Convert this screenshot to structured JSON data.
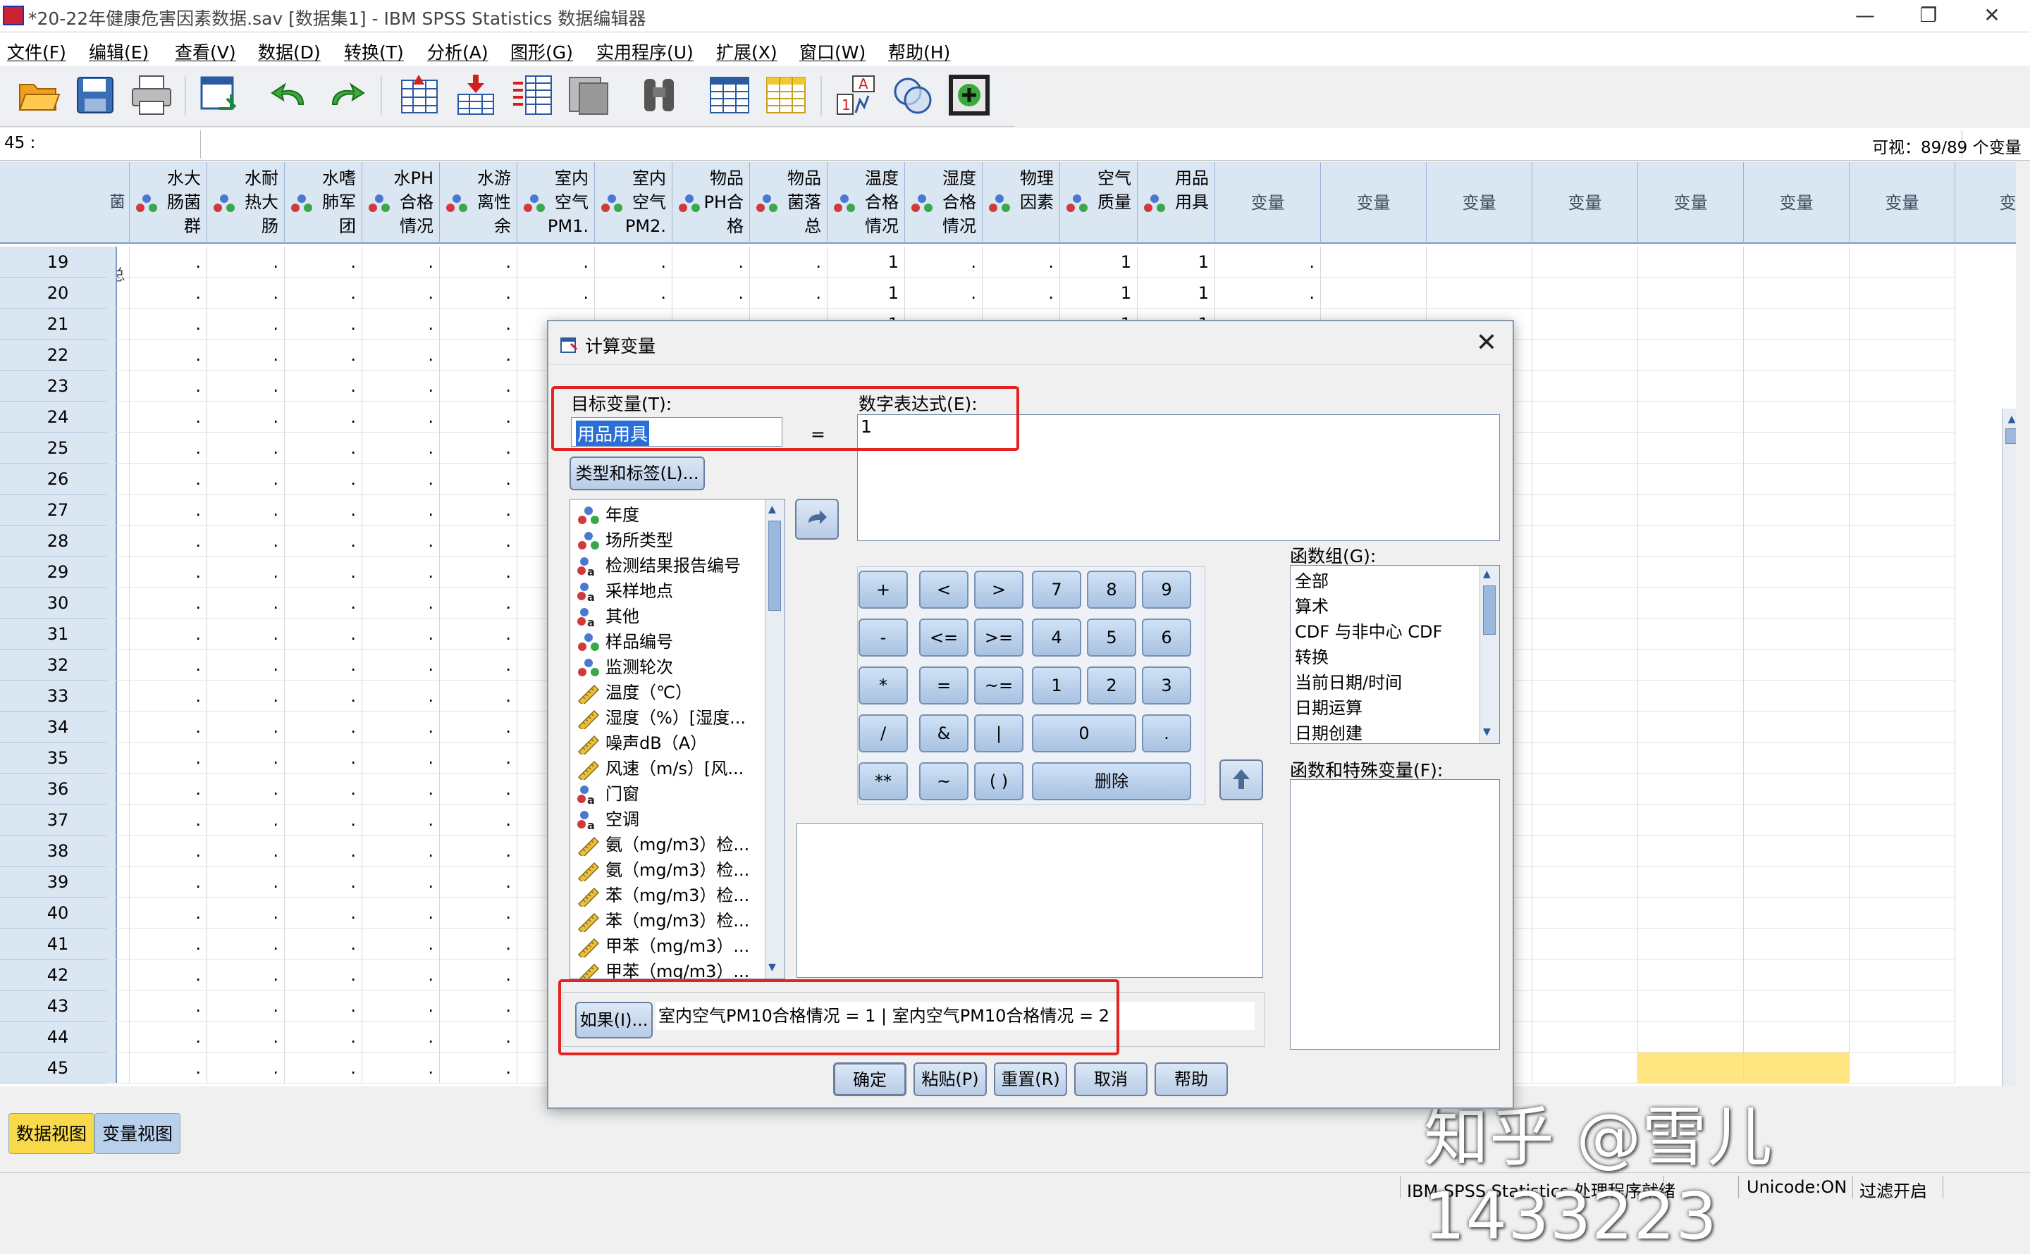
{
  "window": {
    "title": "*20-22年健康危害因素数据.sav [数据集1] - IBM SPSS Statistics 数据编辑器",
    "minimize": "—",
    "restore": "❐",
    "close": "✕"
  },
  "menus": [
    "文件(F)",
    "编辑(E)",
    "查看(V)",
    "数据(D)",
    "转换(T)",
    "分析(A)",
    "图形(G)",
    "实用程序(U)",
    "扩展(X)",
    "窗口(W)",
    "帮助(H)"
  ],
  "toolbar_icons": [
    "open-icon",
    "save-icon",
    "print-icon",
    "dialog-recall-icon",
    "undo-icon",
    "redo-icon",
    "goto-case-icon",
    "goto-variable-icon",
    "variables-icon",
    "run-descriptives-icon",
    "find-icon",
    "insert-cases-icon",
    "insert-variable-icon",
    "split-file-icon",
    "weight-cases-icon",
    "select-cases-icon",
    "value-labels-icon",
    "use-sets-icon"
  ],
  "cell_editor": {
    "reference": "45 :",
    "visible_count": "可视：89/89 个变量"
  },
  "columns": [
    {
      "label": "菌总",
      "partial": true
    },
    {
      "label": "水大肠菌群"
    },
    {
      "label": "水耐热大肠"
    },
    {
      "label": "水嗜肺军团"
    },
    {
      "label": "水PH合格情况"
    },
    {
      "label": "水游离性余"
    },
    {
      "label": "室内空气PM1."
    },
    {
      "label": "室内空气PM2."
    },
    {
      "label": "物品PH合格"
    },
    {
      "label": "物品菌落总"
    },
    {
      "label": "温度合格情况"
    },
    {
      "label": "湿度合格情况"
    },
    {
      "label": "物理因素"
    },
    {
      "label": "空气质量"
    },
    {
      "label": "用品用具"
    },
    {
      "label": "变量"
    },
    {
      "label": "变量"
    },
    {
      "label": "变量"
    },
    {
      "label": "变量"
    },
    {
      "label": "变量"
    },
    {
      "label": "变量"
    },
    {
      "label": "变量"
    },
    {
      "label": "变",
      "partial": true
    }
  ],
  "rows": [
    {
      "n": "19",
      "cells": [
        ".",
        ".",
        ".",
        ".",
        ".",
        ".",
        ".",
        ".",
        ".",
        "1",
        ".",
        ".",
        "1",
        "1",
        "."
      ]
    },
    {
      "n": "20",
      "cells": [
        ".",
        ".",
        ".",
        ".",
        ".",
        ".",
        ".",
        ".",
        ".",
        "1",
        ".",
        ".",
        "1",
        "1",
        "."
      ]
    },
    {
      "n": "21",
      "cells": [
        ".",
        ".",
        ".",
        ".",
        ".",
        ".",
        ".",
        ".",
        ".",
        "1",
        ".",
        ".",
        "1",
        "1",
        "."
      ]
    },
    {
      "n": "22",
      "cells": [
        ".",
        ".",
        ".",
        ".",
        ".",
        "."
      ]
    },
    {
      "n": "23",
      "cells": [
        ".",
        ".",
        ".",
        ".",
        ".",
        "."
      ]
    },
    {
      "n": "24",
      "cells": [
        ".",
        ".",
        ".",
        ".",
        ".",
        "."
      ]
    },
    {
      "n": "25",
      "cells": [
        ".",
        ".",
        ".",
        ".",
        ".",
        "."
      ]
    },
    {
      "n": "26",
      "cells": [
        ".",
        ".",
        ".",
        ".",
        ".",
        "."
      ]
    },
    {
      "n": "27",
      "cells": [
        ".",
        ".",
        ".",
        ".",
        ".",
        "."
      ]
    },
    {
      "n": "28",
      "cells": [
        ".",
        ".",
        ".",
        ".",
        ".",
        "."
      ]
    },
    {
      "n": "29",
      "cells": [
        ".",
        ".",
        ".",
        ".",
        ".",
        "."
      ]
    },
    {
      "n": "30",
      "cells": [
        ".",
        ".",
        ".",
        ".",
        ".",
        "."
      ]
    },
    {
      "n": "31",
      "cells": [
        ".",
        ".",
        ".",
        ".",
        ".",
        "."
      ]
    },
    {
      "n": "32",
      "cells": [
        ".",
        ".",
        ".",
        ".",
        ".",
        "."
      ]
    },
    {
      "n": "33",
      "cells": [
        ".",
        ".",
        ".",
        ".",
        ".",
        "."
      ]
    },
    {
      "n": "34",
      "cells": [
        ".",
        ".",
        ".",
        ".",
        ".",
        "."
      ]
    },
    {
      "n": "35",
      "cells": [
        ".",
        ".",
        ".",
        ".",
        ".",
        "."
      ]
    },
    {
      "n": "36",
      "cells": [
        ".",
        ".",
        ".",
        ".",
        ".",
        "."
      ]
    },
    {
      "n": "37",
      "cells": [
        ".",
        ".",
        ".",
        ".",
        ".",
        "."
      ]
    },
    {
      "n": "38",
      "cells": [
        ".",
        ".",
        ".",
        ".",
        ".",
        "."
      ]
    },
    {
      "n": "39",
      "cells": [
        ".",
        ".",
        ".",
        ".",
        ".",
        "."
      ]
    },
    {
      "n": "40",
      "cells": [
        ".",
        ".",
        ".",
        ".",
        ".",
        "."
      ]
    },
    {
      "n": "41",
      "cells": [
        ".",
        ".",
        ".",
        ".",
        ".",
        "."
      ]
    },
    {
      "n": "42",
      "cells": [
        ".",
        ".",
        ".",
        ".",
        ".",
        "."
      ]
    },
    {
      "n": "43",
      "cells": [
        ".",
        ".",
        ".",
        ".",
        ".",
        "."
      ]
    },
    {
      "n": "44",
      "cells": [
        ".",
        ".",
        ".",
        ".",
        ".",
        "."
      ]
    },
    {
      "n": "45",
      "cells": [
        ".",
        ".",
        ".",
        ".",
        ".",
        "."
      ]
    }
  ],
  "dialog": {
    "title": "计算变量",
    "close": "✕",
    "target_label": "目标变量(T):",
    "target_value": "用品用具",
    "equals": "=",
    "expression_label": "数字表达式(E):",
    "expression_value": "1",
    "type_label_button": "类型和标签(L)...",
    "variables": [
      {
        "label": "年度",
        "type": "nominal"
      },
      {
        "label": "场所类型",
        "type": "nominal"
      },
      {
        "label": "检测结果报告编号",
        "type": "nominal-string"
      },
      {
        "label": "采样地点",
        "type": "nominal-string"
      },
      {
        "label": "其他",
        "type": "nominal-string"
      },
      {
        "label": "样品编号",
        "type": "nominal"
      },
      {
        "label": "监测轮次",
        "type": "nominal"
      },
      {
        "label": "温度（℃）",
        "type": "scale"
      },
      {
        "label": "湿度（%）[湿度...",
        "type": "scale"
      },
      {
        "label": "噪声dB（A）",
        "type": "scale"
      },
      {
        "label": "风速（m/s）[风...",
        "type": "scale"
      },
      {
        "label": "门窗",
        "type": "nominal-string"
      },
      {
        "label": "空调",
        "type": "nominal-string"
      },
      {
        "label": "氨（mg/m3）检...",
        "type": "scale"
      },
      {
        "label": "氨（mg/m3）检...",
        "type": "scale"
      },
      {
        "label": "苯（mg/m3）检...",
        "type": "scale"
      },
      {
        "label": "苯（mg/m3）检...",
        "type": "scale"
      },
      {
        "label": "甲苯（mg/m3）...",
        "type": "scale"
      },
      {
        "label": "甲苯（mg/m3）...",
        "type": "scale"
      }
    ],
    "keypad": [
      [
        "+",
        "<",
        ">",
        "7",
        "8",
        "9"
      ],
      [
        "-",
        "<=",
        ">=",
        "4",
        "5",
        "6"
      ],
      [
        "*",
        "=",
        "~=",
        "1",
        "2",
        "3"
      ],
      [
        "/",
        "&",
        "|",
        "0",
        "."
      ],
      [
        "**",
        "~",
        "( )",
        "删除"
      ]
    ],
    "function_group_label": "函数组(G):",
    "function_groups": [
      "全部",
      "算术",
      "CDF 与非中心 CDF",
      "转换",
      "当前日期/时间",
      "日期运算",
      "日期创建"
    ],
    "functions_label": "函数和特殊变量(F):",
    "if_button": "如果(I)...",
    "if_condition": "室内空气PM10合格情况 = 1 | 室内空气PM10合格情况 = 2",
    "buttons": {
      "ok": "确定",
      "paste": "粘贴(P)",
      "reset": "重置(R)",
      "cancel": "取消",
      "help": "帮助"
    }
  },
  "tabs": {
    "data_view": "数据视图",
    "variable_view": "变量视图"
  },
  "status": {
    "processor": "IBM SPSS Statistics 处理程序就绪",
    "unicode": "Unicode:ON",
    "filter": "过滤开启"
  },
  "watermark": "知乎 @雪儿1433223",
  "colors": {
    "highlight_red": "#e32222",
    "header_blue": "#dbe6f3",
    "selected_cell": "#ffe680"
  }
}
